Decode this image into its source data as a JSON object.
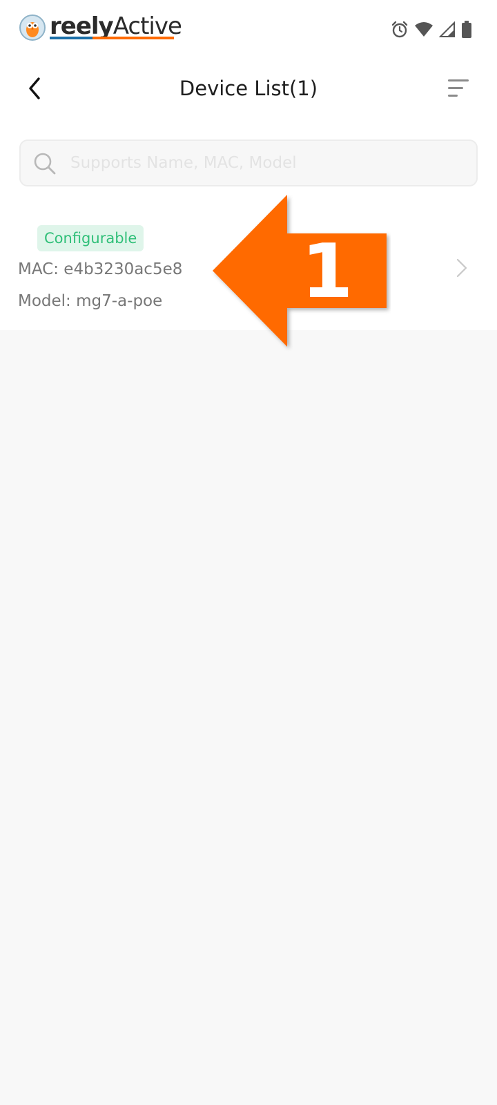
{
  "status_bar": {
    "logo_text_bold": "reely",
    "logo_text_regular": "Active",
    "icons": [
      "alarm-icon",
      "wifi-icon",
      "cell-signal-icon",
      "battery-icon"
    ]
  },
  "header": {
    "title": "Device List(1)",
    "back_icon": "chevron-left-icon",
    "sort_icon": "sort-lines-icon"
  },
  "search": {
    "placeholder": "Supports Name, MAC, Model",
    "value": ""
  },
  "devices": [
    {
      "badge": "Configurable",
      "mac": "MAC: e4b3230ac5e8",
      "model": "Model: mg7-a-poe"
    }
  ],
  "annotation": {
    "number": "1",
    "color": "#ff6a00"
  },
  "colors": {
    "badge_text": "#2fbf78",
    "badge_bg": "#dff5ea",
    "logo_blue": "#1b6fa8",
    "logo_orange": "#ff6a00"
  }
}
